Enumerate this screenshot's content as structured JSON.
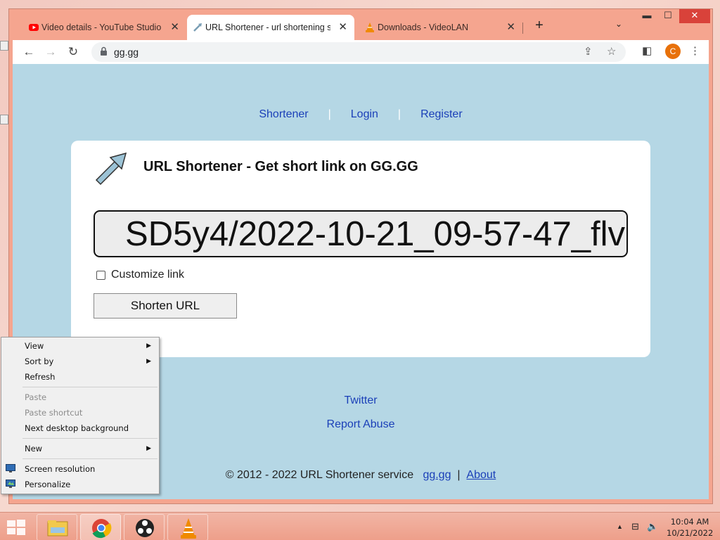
{
  "browser": {
    "tabs": [
      {
        "title": "Video details - YouTube Studio",
        "icon": "youtube-icon"
      },
      {
        "title": "URL Shortener - url shortening se",
        "icon": "arrow-logo-icon",
        "active": true
      },
      {
        "title": "Downloads - VideoLAN",
        "icon": "vlc-cone-icon"
      }
    ],
    "tab_close": "✕",
    "new_tab": "+",
    "tab_list": "⌄",
    "window_controls": {
      "minimize": "▬",
      "maximize": "☐",
      "close": "✕"
    },
    "toolbar": {
      "back": "←",
      "forward": "→",
      "reload": "↻",
      "url": "gg.gg",
      "share": "⇪",
      "bookmark": "☆",
      "side_panel": "◧",
      "profile_initial": "C",
      "menu": "⋮"
    }
  },
  "page": {
    "nav": [
      "Shortener",
      "Login",
      "Register"
    ],
    "nav_sep": "|",
    "heading": "URL Shortener - Get short link on GG.GG",
    "url_input_value": "SD5y4/2022-10-21_09-57-47_flv",
    "customize_label": "Customize link",
    "shorten_button": "Shorten URL",
    "twitter": "Twitter",
    "report_abuse": "Report Abuse",
    "footer": {
      "text": "© 2012 - 2022 URL Shortener service",
      "site_link": "gg.gg",
      "sep": "|",
      "about": "About"
    }
  },
  "context_menu": {
    "items": [
      {
        "label": "View",
        "submenu": true
      },
      {
        "label": "Sort by",
        "submenu": true
      },
      {
        "label": "Refresh"
      },
      {
        "label": "Paste",
        "disabled": true
      },
      {
        "label": "Paste shortcut",
        "disabled": true
      },
      {
        "label": "Next desktop background"
      },
      {
        "label": "New",
        "submenu": true
      },
      {
        "label": "Screen resolution",
        "icon": "monitor-icon"
      },
      {
        "label": "Personalize",
        "icon": "personalize-icon"
      }
    ],
    "arrow": "▶"
  },
  "taskbar": {
    "apps": [
      "file-explorer-icon",
      "chrome-icon",
      "obs-icon",
      "vlc-icon"
    ],
    "tray": {
      "show_hidden": "▲",
      "network": "⊟",
      "volume": "🔈"
    },
    "time": "10:04 AM",
    "date": "10/21/2022"
  },
  "colors": {
    "page_bg": "#b5d7e5",
    "frame": "#f5a58f",
    "link": "#1a3fb8",
    "close_button": "#d9423a"
  }
}
